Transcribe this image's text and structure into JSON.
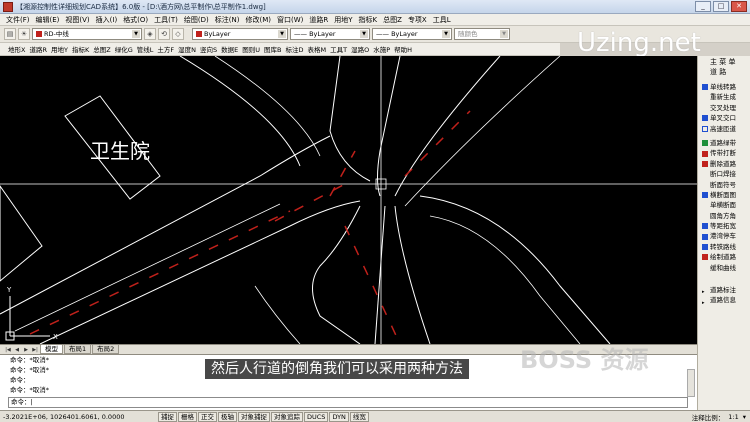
{
  "window": {
    "title": "【湘源控制性详细规划CAD系统】6.0版 - [D:\\酒方网\\总平制作\\总平制作1.dwg]",
    "buttons": [
      "_",
      "□",
      "✕"
    ]
  },
  "menu": [
    "文件(F)",
    "编辑(E)",
    "视图(V)",
    "插入(I)",
    "格式(O)",
    "工具(T)",
    "绘图(D)",
    "标注(N)",
    "修改(M)",
    "窗口(W)",
    "道路R",
    "用地Y",
    "指标K",
    "总图Z",
    "专项X",
    "工具L"
  ],
  "toolbar": {
    "layer": "RD-中线",
    "color": "ByLayer",
    "linetype": "ByLayer",
    "lineweight": "ByLayer",
    "plotstyle": "随颜色"
  },
  "toolbar2": [
    "地形X",
    "道路R",
    "用地Y",
    "指标K",
    "总图Z",
    "绿化G",
    "管线L",
    "土方F",
    "湿度N",
    "竖向S",
    "数据E",
    "图则U",
    "图库B",
    "标注D",
    "表格M",
    "工具T",
    "湿路O",
    "水施P",
    "帮助H"
  ],
  "logo": "Uzing.net",
  "canvas": {
    "label_text": "卫生院",
    "axis_y": "Y",
    "axis_x": "X"
  },
  "right_panel": {
    "header1": "主 菜 单",
    "header2": "道 路",
    "items": [
      "单线转路",
      "重新生成",
      "交叉处理",
      "单叉交口",
      "高速匝道",
      "道路绿带",
      "传带打断",
      "删除道路",
      "断口焊接",
      "断面符号",
      "横断面图",
      "单横断面",
      "圆角方角",
      "等距拓宽",
      "港湾停车",
      "转铁路线",
      "绘制道路",
      "缓和曲线"
    ],
    "footer": [
      "道路标注",
      "道路信息"
    ],
    "colors": {
      "blue": "#1f4fd0",
      "red": "#c0211b",
      "green": "#1e8f3a"
    }
  },
  "tabs": [
    "模型",
    "布局1",
    "布局2"
  ],
  "command_lines": [
    "命令：*取消*",
    "命令：*取消*",
    "命令：",
    "命令：*取消*"
  ],
  "command_prompt": "命令：",
  "subtitle": "然后人行道的倒角我们可以采用两种方法",
  "watermark": "BOSS 资源",
  "status": {
    "coords": "-3.2021E+06, 1026401.6061, 0.0000",
    "buttons": [
      "捕捉",
      "栅格",
      "正交",
      "极轴",
      "对象捕捉",
      "对象追踪",
      "DUCS",
      "DYN",
      "线宽"
    ],
    "scale_label": "注释比例：",
    "scale_value": "1:1"
  }
}
